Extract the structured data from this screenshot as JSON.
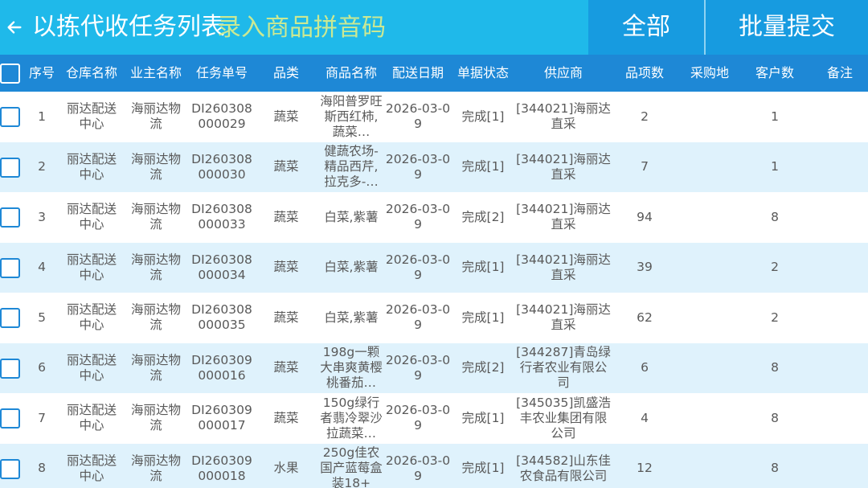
{
  "header": {
    "back_icon": "arrow-left-icon",
    "title": "以拣代收任务列表",
    "search_placeholder": "录入商品拼音码",
    "all_button": "全部",
    "batch_submit_button": "批量提交",
    "colors": {
      "topbar": "#1fb9ea",
      "button_bg": "#179be0",
      "placeholder": "#cbe993"
    }
  },
  "table": {
    "columns": [
      "序号",
      "仓库名称",
      "业主名称",
      "任务单号",
      "品类",
      "商品名称",
      "配送日期",
      "单据状态",
      "供应商",
      "品项数",
      "采购地",
      "客户数",
      "备注"
    ],
    "colors": {
      "header_bg": "#1e88d6",
      "row_alt_bg": "#dff2fc",
      "checkbox_border": "#1e88d6"
    },
    "rows": [
      {
        "no": "1",
        "warehouse": "丽达配送中心",
        "owner": "海丽达物流",
        "task_no": "DI260308000029",
        "category": "蔬菜",
        "goods": "海阳普罗旺斯西红柿,蔬菜…",
        "date": "2026-03-09",
        "status": "完成[1]",
        "supplier": "[344021]海丽达直采",
        "items": "2",
        "purchase_place": "",
        "customers": "1",
        "note": ""
      },
      {
        "no": "2",
        "warehouse": "丽达配送中心",
        "owner": "海丽达物流",
        "task_no": "DI260308000030",
        "category": "蔬菜",
        "goods": "健蔬农场-精品西芹,拉克多-…",
        "date": "2026-03-09",
        "status": "完成[1]",
        "supplier": "[344021]海丽达直采",
        "items": "7",
        "purchase_place": "",
        "customers": "1",
        "note": ""
      },
      {
        "no": "3",
        "warehouse": "丽达配送中心",
        "owner": "海丽达物流",
        "task_no": "DI260308000033",
        "category": "蔬菜",
        "goods": "白菜,紫薯",
        "date": "2026-03-09",
        "status": "完成[2]",
        "supplier": "[344021]海丽达直采",
        "items": "94",
        "purchase_place": "",
        "customers": "8",
        "note": ""
      },
      {
        "no": "4",
        "warehouse": "丽达配送中心",
        "owner": "海丽达物流",
        "task_no": "DI260308000034",
        "category": "蔬菜",
        "goods": "白菜,紫薯",
        "date": "2026-03-09",
        "status": "完成[1]",
        "supplier": "[344021]海丽达直采",
        "items": "39",
        "purchase_place": "",
        "customers": "2",
        "note": ""
      },
      {
        "no": "5",
        "warehouse": "丽达配送中心",
        "owner": "海丽达物流",
        "task_no": "DI260308000035",
        "category": "蔬菜",
        "goods": "白菜,紫薯",
        "date": "2026-03-09",
        "status": "完成[1]",
        "supplier": "[344021]海丽达直采",
        "items": "62",
        "purchase_place": "",
        "customers": "2",
        "note": ""
      },
      {
        "no": "6",
        "warehouse": "丽达配送中心",
        "owner": "海丽达物流",
        "task_no": "DI260309000016",
        "category": "蔬菜",
        "goods": "198g一颗大串爽黄樱桃番茄…",
        "date": "2026-03-09",
        "status": "完成[2]",
        "supplier": "[344287]青岛绿行者农业有限公司",
        "items": "6",
        "purchase_place": "",
        "customers": "8",
        "note": ""
      },
      {
        "no": "7",
        "warehouse": "丽达配送中心",
        "owner": "海丽达物流",
        "task_no": "DI260309000017",
        "category": "蔬菜",
        "goods": "150g绿行者翡冷翠沙拉蔬菜…",
        "date": "2026-03-09",
        "status": "完成[1]",
        "supplier": "[345035]凯盛浩丰农业集团有限公司",
        "items": "4",
        "purchase_place": "",
        "customers": "8",
        "note": ""
      },
      {
        "no": "8",
        "warehouse": "丽达配送中心",
        "owner": "海丽达物流",
        "task_no": "DI260309000018",
        "category": "水果",
        "goods": "250g佳农国产蓝莓盒装18+",
        "date": "2026-03-09",
        "status": "完成[1]",
        "supplier": "[344582]山东佳农食品有限公司",
        "items": "12",
        "purchase_place": "",
        "customers": "8",
        "note": ""
      }
    ]
  }
}
